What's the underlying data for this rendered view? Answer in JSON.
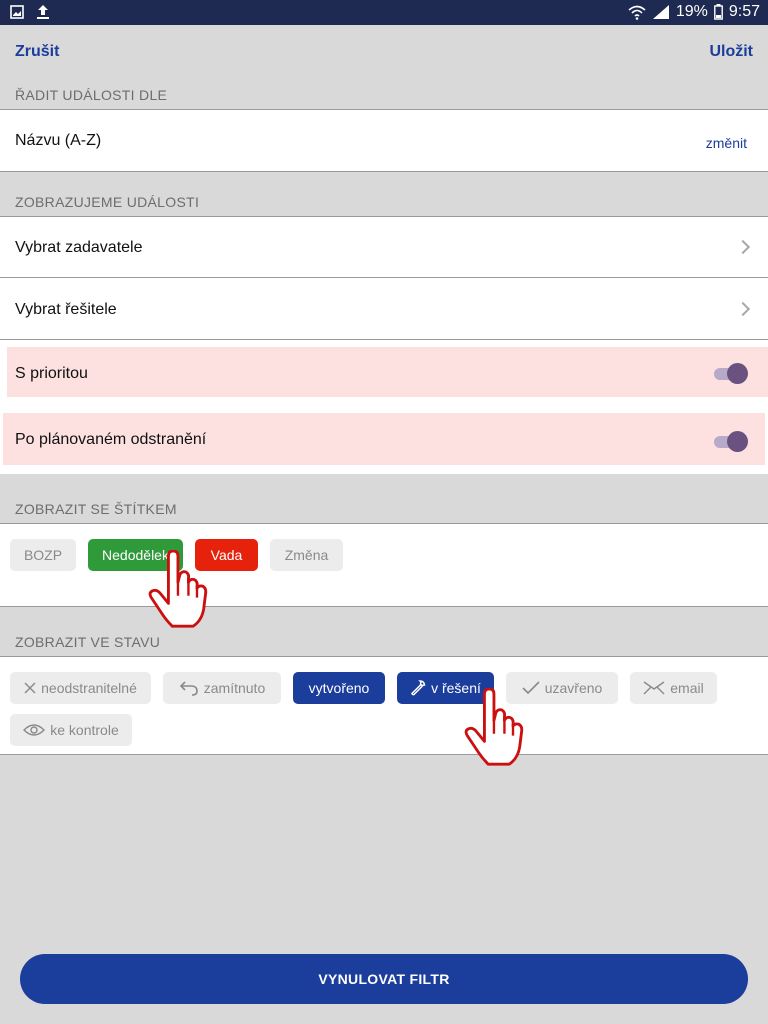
{
  "status_bar": {
    "battery": "19%",
    "time": "9:57"
  },
  "top_bar": {
    "cancel_label": "Zrušit",
    "save_label": "Uložit"
  },
  "sort_section": {
    "header": "ŘADIT UDÁLOSTI DLE",
    "value": "Názvu (A-Z)",
    "change_label": "změnit"
  },
  "show_events_section": {
    "header": "ZOBRAZUJEME UDÁLOSTI",
    "select_submitter": "Vybrat zadavatele",
    "select_solver": "Vybrat řešitele",
    "with_priority": {
      "label": "S prioritou",
      "checked": true
    },
    "after_planned_removal": {
      "label": "Po plánovaném odstranění",
      "checked": true
    }
  },
  "tag_section": {
    "header": "ZOBRAZIT SE ŠTÍTKEM",
    "tags": [
      {
        "label": "BOZP",
        "selected": false,
        "color": "#ececec"
      },
      {
        "label": "Nedodělek",
        "selected": true,
        "color": "#2f9a3a"
      },
      {
        "label": "Vada",
        "selected": true,
        "color": "#e6210c"
      },
      {
        "label": "Změna",
        "selected": false,
        "color": "#ececec"
      }
    ]
  },
  "state_section": {
    "header": "ZOBRAZIT VE STAVU",
    "states": [
      {
        "label": "neodstranitelné",
        "icon": "close-icon",
        "selected": false
      },
      {
        "label": "zamítnuto",
        "icon": "undo-icon",
        "selected": false
      },
      {
        "label": "vytvořeno",
        "icon": "",
        "selected": true
      },
      {
        "label": "v řešení",
        "icon": "wrench-icon",
        "selected": true
      },
      {
        "label": "uzavřeno",
        "icon": "check-icon",
        "selected": false
      },
      {
        "label": "email",
        "icon": "mail-icon",
        "selected": false
      },
      {
        "label": "ke kontrole",
        "icon": "eye-icon",
        "selected": false
      }
    ]
  },
  "reset_button": {
    "label": "VYNULOVAT FILTR"
  },
  "colors": {
    "accent": "#1b3d9b",
    "status_bar": "#1e2a52",
    "highlight_row": "#fde1e1",
    "toggle_on": "#6a5180"
  }
}
